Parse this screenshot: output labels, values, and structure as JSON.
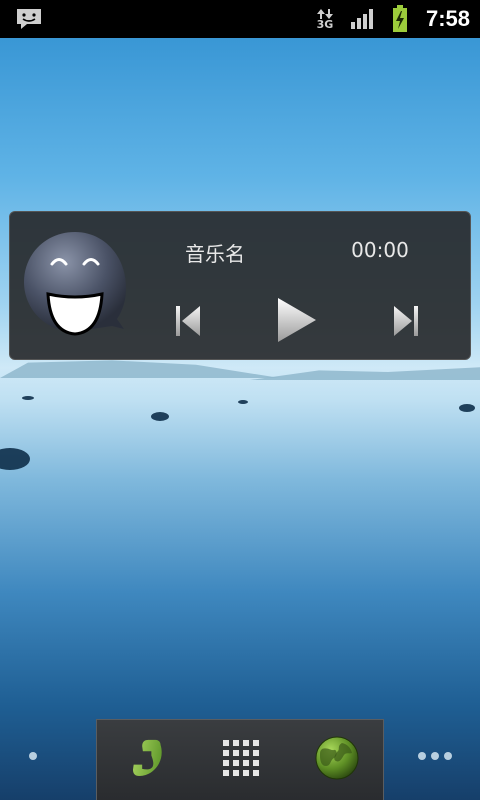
{
  "status_bar": {
    "time": "7:58",
    "network_label": "3G",
    "icons": [
      "message-notification-icon",
      "data-3g-icon",
      "signal-icon",
      "battery-charging-icon"
    ]
  },
  "music_widget": {
    "song_name": "音乐名",
    "time": "00:00",
    "icons": [
      "avatar-smiley-icon",
      "previous-track-icon",
      "play-icon",
      "next-track-icon"
    ]
  },
  "dock": {
    "icons": [
      "phone-icon",
      "app-drawer-icon",
      "browser-globe-icon"
    ]
  },
  "home_pages": {
    "left_indicator": "dot",
    "right_indicator": "dots"
  },
  "colors": {
    "statusbar": "#000000",
    "widget_bg": "#2a2c2f",
    "accent_green": "#8bc34a"
  }
}
